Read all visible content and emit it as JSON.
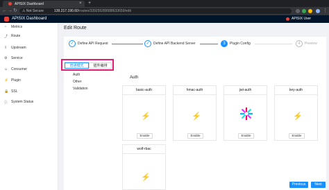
{
  "browser": {
    "tab_title": "APISIX Dashboard",
    "close_glyph": "×",
    "new_tab_glyph": "+",
    "security": "⚠ Not Secure",
    "url_host": "139.217.190.60",
    "url_path": "/routes/339255289588633659/edit"
  },
  "app": {
    "title": "APISIX Dashboard",
    "user": "APISIX User",
    "brand_color": "#e8433a"
  },
  "sidebar": {
    "items": [
      {
        "icon": "metrics-icon",
        "glyph": "◔",
        "label": "Metrics"
      },
      {
        "icon": "route-icon",
        "glyph": "⤴",
        "label": "Route"
      },
      {
        "icon": "upstream-icon",
        "glyph": "⇪",
        "label": "Upstream"
      },
      {
        "icon": "service-icon",
        "glyph": "⚙",
        "label": "Service"
      },
      {
        "icon": "consumer-icon",
        "glyph": "☺",
        "label": "Consumer"
      },
      {
        "icon": "plugin-icon",
        "glyph": "⚡",
        "label": "Plugin"
      },
      {
        "icon": "ssl-icon",
        "glyph": "🔒",
        "label": "SSL"
      },
      {
        "icon": "system-status-icon",
        "glyph": "ⓘ",
        "label": "System Status"
      }
    ]
  },
  "main": {
    "page_title": "Edit Route",
    "steps": [
      {
        "index": "✓",
        "label": "Define API Request",
        "status": "finish"
      },
      {
        "index": "✓",
        "label": "Define API Backend Server",
        "status": "finish"
      },
      {
        "index": "3",
        "label": "Plugin Config",
        "status": "process"
      },
      {
        "index": "4",
        "label": "Preview",
        "status": "wait"
      }
    ],
    "mode_tabs": [
      "普通模式",
      "插件编排"
    ],
    "categories": [
      "Auth",
      "Other",
      "Validation"
    ],
    "section_title": "Auth",
    "cards": [
      {
        "name": "basic-auth",
        "button": "Enable"
      },
      {
        "name": "hmac-auth",
        "button": "Enable"
      },
      {
        "name": "jwt-auth",
        "button": "Enable"
      },
      {
        "name": "key-auth",
        "button": "Enable"
      },
      {
        "name": "wolf-rbac",
        "button": ""
      }
    ],
    "previous": "Previous",
    "next": "Next",
    "accent_color": "#1890ff",
    "highlight_color": "#e11d74"
  }
}
